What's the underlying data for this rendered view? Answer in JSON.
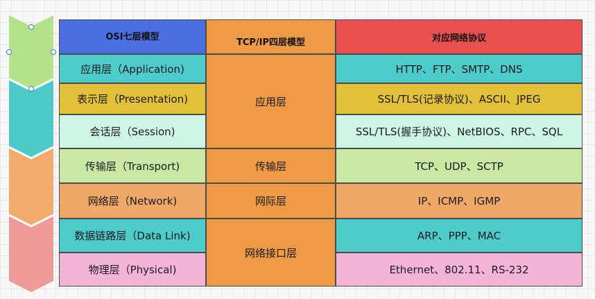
{
  "header": {
    "osi": "OSI七层模型",
    "tcpip": "TCP/IP四层模型",
    "protocols": "对应网络协议"
  },
  "osi_layers": [
    "应用层（Application)",
    "表示层（Presentation)",
    "会话层（Session)",
    "传输层（Transport)",
    "网络层（Network)",
    "数据链路层（Data Link)",
    "物理层（Physical)"
  ],
  "tcpip_layers": [
    "应用层",
    "传输层",
    "网际层",
    "网络接口层"
  ],
  "protocols": [
    "HTTP、FTP、SMTP、DNS",
    "SSL/TLS(记录协议)、ASCII、JPEG",
    "SSL/TLS(握手协议)、NetBIOS、RPC、SQL",
    "TCP、UDP、SCTP",
    "IP、ICMP、IGMP",
    "ARP、PPP、MAC",
    "Ethernet、802.11、RS-232"
  ],
  "colors": {
    "osi_header": "#4a6fe0",
    "tcpip": "#ef9a45",
    "protocol_header": "#ea5050",
    "application": "#4ecbcb",
    "presentation": "#e2c03a",
    "session": "#cdf7e2",
    "transport": "#c8e8a4",
    "network": "#f0a868",
    "datalink": "#4ecbcb",
    "physical": "#f4b4d6",
    "arrow_green": "#b3e28a",
    "arrow_teal": "#4ec9c9",
    "arrow_orange": "#f1ab6c",
    "arrow_pink": "#f09a9a"
  }
}
